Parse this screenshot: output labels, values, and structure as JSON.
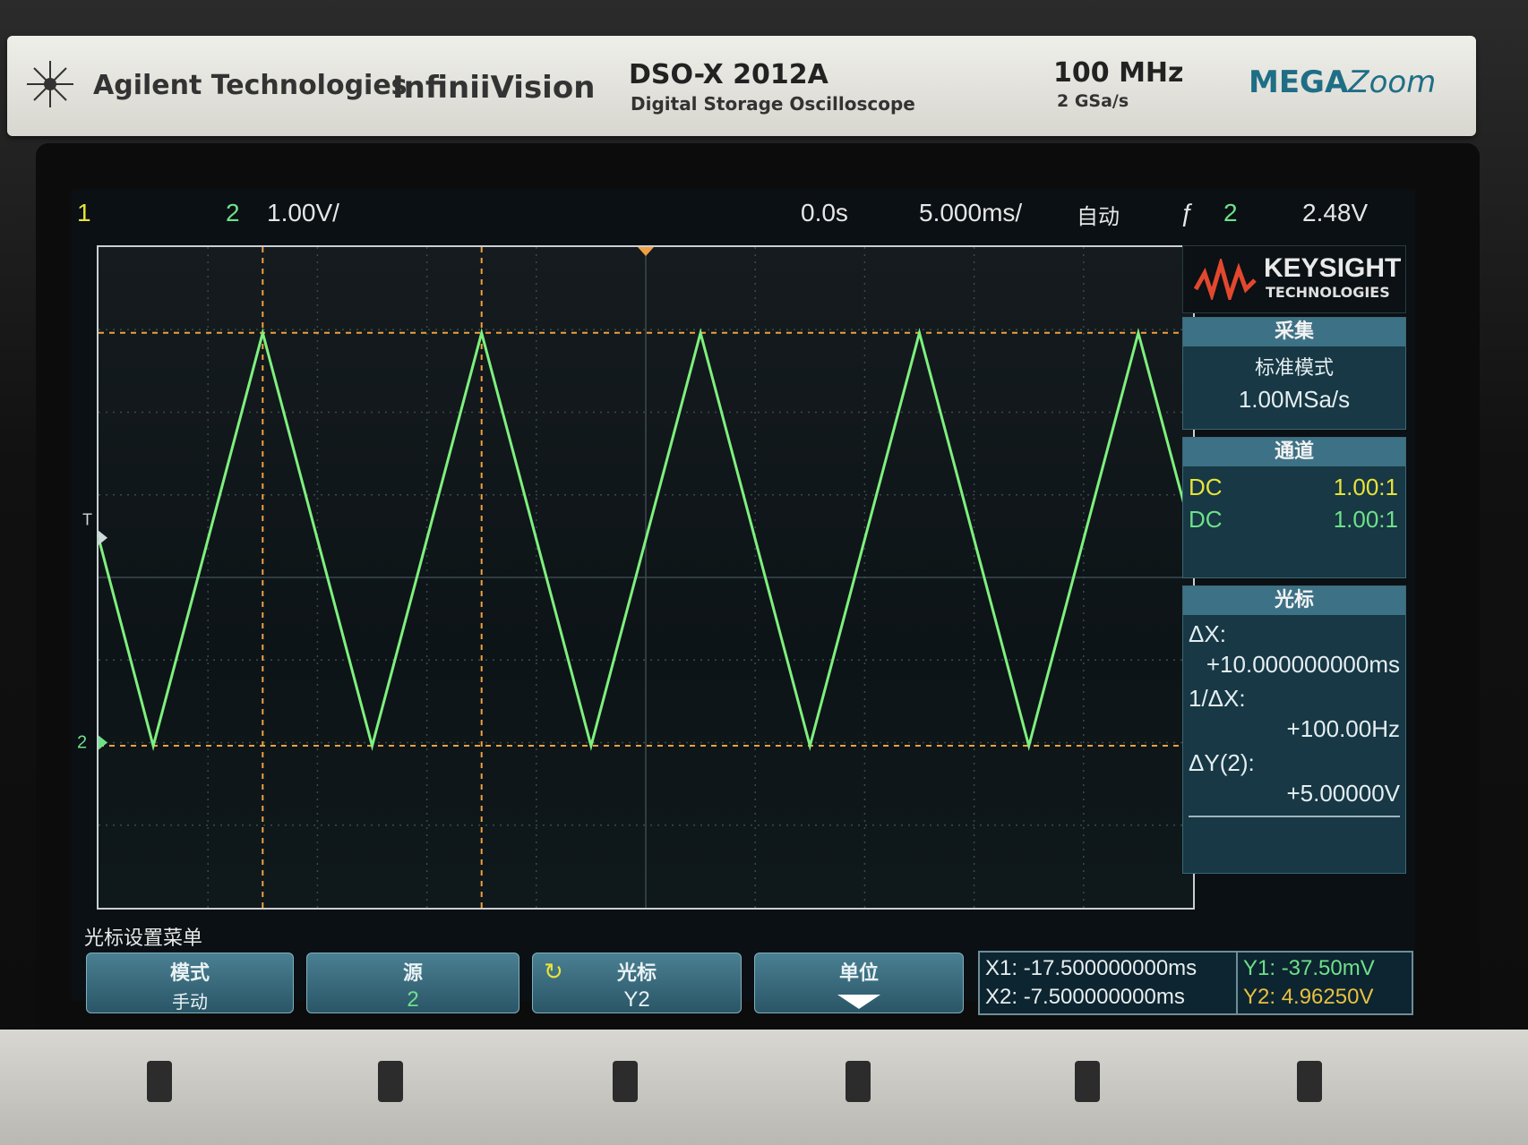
{
  "brand": {
    "company": "Agilent Technologies",
    "series": "InfiniiVision",
    "model": "DSO-X 2012A",
    "model_desc": "Digital Storage Oscilloscope",
    "bandwidth": "100 MHz",
    "sample_rate": "2 GSa/s",
    "megazoom_mega": "MEGA",
    "megazoom_zoom": "Zoom"
  },
  "status": {
    "ch1_label": "1",
    "ch2_label": "2",
    "ch2_scale": "1.00V/",
    "time_delay": "0.0s",
    "time_scale": "5.000ms/",
    "trigger_mode": "自动",
    "trigger_symbol": "ƒ",
    "trigger_source": "2",
    "trigger_level": "2.48V"
  },
  "side": {
    "logo_main": "KEYSIGHT",
    "logo_sub": "TECHNOLOGIES",
    "acq_title": "采集",
    "acq_mode": "标准模式",
    "acq_rate": "1.00MSa/s",
    "chan_title": "通道",
    "chan_rows": [
      {
        "coupling": "DC",
        "probe": "1.00:1"
      },
      {
        "coupling": "DC",
        "probe": "1.00:1"
      }
    ],
    "cursor_title": "光标",
    "dx_label": "ΔX:",
    "dx_value": "+10.000000000ms",
    "inv_dx_label": "1/ΔX:",
    "inv_dx_value": "+100.00Hz",
    "dy_label": "ΔY(2):",
    "dy_value": "+5.00000V"
  },
  "softkeys": {
    "menu_title": "光标设置菜单",
    "mode_label": "模式",
    "mode_value": "手动",
    "source_label": "源",
    "source_value": "2",
    "cursor_label": "光标",
    "cursor_value": "Y2",
    "units_label": "单位"
  },
  "readout": {
    "x1": "X1: -17.500000000ms",
    "x2": "X2: -7.500000000ms",
    "y1": "Y1: -37.50mV",
    "y2": "Y2: 4.96250V"
  },
  "markers": {
    "trigger_marker": "T",
    "ground_marker": "2"
  },
  "colors": {
    "trace": "#7ef07e",
    "cursor": "#f0a040",
    "ch1": "#e8e23a",
    "ch2": "#6fe08a",
    "panel_head": "#3d7185"
  },
  "chart_data": {
    "type": "line",
    "time_per_div_ms": 5,
    "volts_per_div": 1,
    "h_divisions": 10,
    "v_divisions": 8,
    "series": [
      {
        "name": "2",
        "x": [
          -25,
          -22.5,
          -17.5,
          -12.5,
          -7.5,
          -2.5,
          2.5,
          7.5,
          12.5,
          17.5,
          22.5,
          25
        ],
        "y": [
          2.48,
          -0.04,
          4.96,
          -0.04,
          4.96,
          -0.04,
          4.96,
          -0.04,
          4.96,
          -0.04,
          4.96,
          2.48
        ]
      }
    ],
    "cursors": {
      "x1_ms": -17.5,
      "x2_ms": -7.5,
      "y1_v": -0.0375,
      "y2_v": 4.9625
    },
    "trigger_level_v": 2.48
  }
}
